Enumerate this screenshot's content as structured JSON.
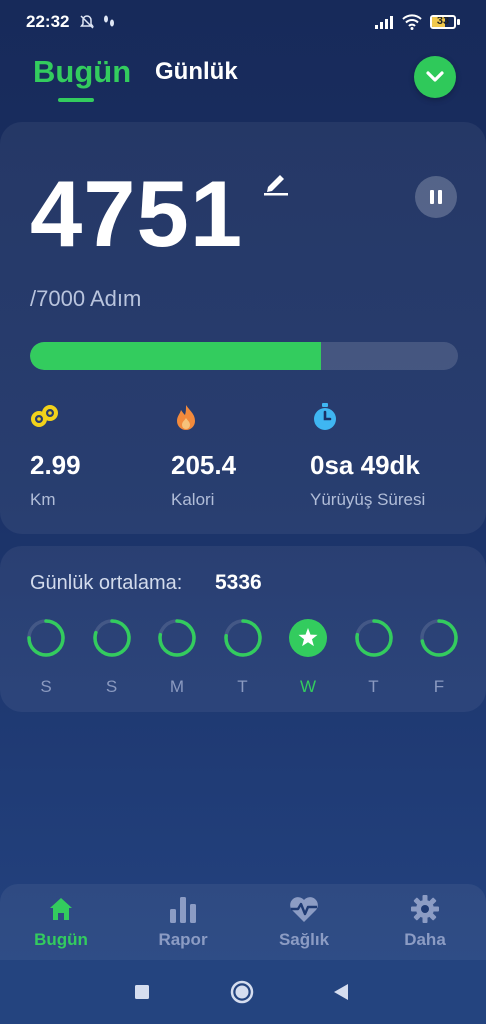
{
  "status_bar": {
    "time": "22:32",
    "battery": "33"
  },
  "header": {
    "tab_today": "Bugün",
    "tab_daily": "Günlük"
  },
  "steps": {
    "value": "4751",
    "goal_text": "/7000 Adım",
    "progress": 0.679
  },
  "stats": [
    {
      "icon": "distance-icon",
      "value": "2.99",
      "label": "Km",
      "color": "#f2d21b"
    },
    {
      "icon": "flame-icon",
      "value": "205.4",
      "label": "Kalori",
      "color": "#f28a3c"
    },
    {
      "icon": "stopwatch-icon",
      "value": "0sa 49dk",
      "label": "Yürüyüş Süresi",
      "color": "#3fb6f2"
    }
  ],
  "weekly": {
    "avg_label": "Günlük ortalama:",
    "avg_value": "5336",
    "days": [
      {
        "label": "S",
        "fraction": 0.75,
        "goal_met": false
      },
      {
        "label": "S",
        "fraction": 0.8,
        "goal_met": false
      },
      {
        "label": "M",
        "fraction": 0.78,
        "goal_met": false
      },
      {
        "label": "T",
        "fraction": 0.77,
        "goal_met": false
      },
      {
        "label": "W",
        "fraction": 1.0,
        "goal_met": true
      },
      {
        "label": "T",
        "fraction": 0.78,
        "goal_met": false
      },
      {
        "label": "F",
        "fraction": 0.72,
        "goal_met": false
      }
    ]
  },
  "nav": [
    {
      "icon": "home-icon",
      "label": "Bugün",
      "active": true
    },
    {
      "icon": "bar-chart-icon",
      "label": "Rapor",
      "active": false
    },
    {
      "icon": "heart-pulse-icon",
      "label": "Sağlık",
      "active": false
    },
    {
      "icon": "gear-icon",
      "label": "Daha",
      "active": false
    }
  ],
  "colors": {
    "accent": "#33cc5e",
    "background": "#1b3166",
    "muted": "#8b9ac0"
  }
}
